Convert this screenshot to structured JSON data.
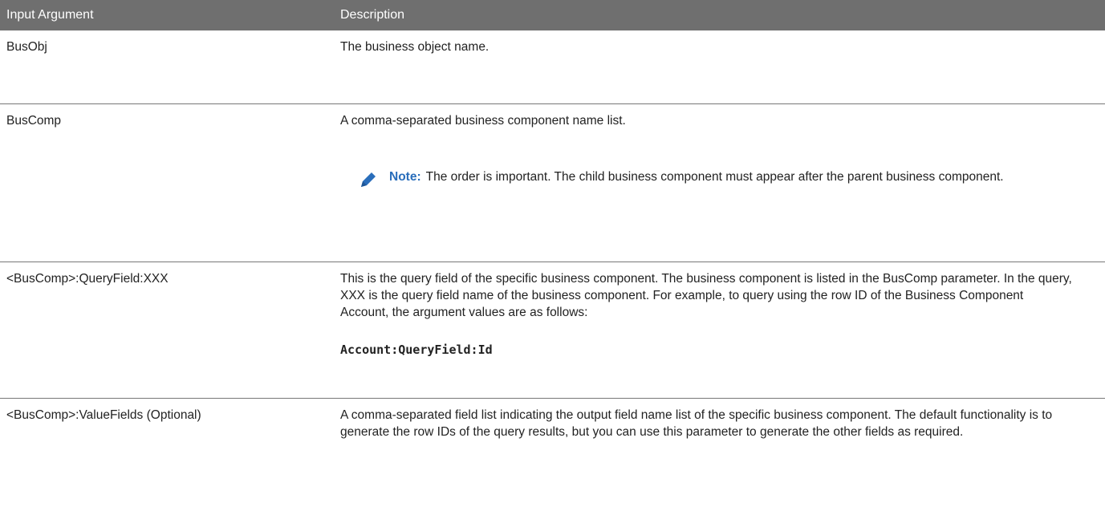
{
  "table": {
    "headers": [
      "Input Argument",
      "Description"
    ],
    "rows": [
      {
        "argument": "BusObj",
        "description": "The business object name."
      },
      {
        "argument": "BusComp",
        "description": "A comma-separated business component name list.",
        "note_label": "Note:",
        "note_text": "The order is important. The child business component must appear after the parent business component."
      },
      {
        "argument": "<BusComp>:QueryField:XXX",
        "description": "This is the query field of the specific business component. The business component is listed in the BusComp parameter. In the query, XXX is the query field name of the business component. For example, to query using the row ID of the Business Component Account, the argument values are as follows:",
        "code": "Account:QueryField:Id"
      },
      {
        "argument": "<BusComp>:ValueFields (Optional)",
        "description": "A comma-separated field list indicating the output field name list of the specific business component. The default functionality is to generate the row IDs of the query results, but you can use this parameter to generate the other fields as required."
      }
    ]
  },
  "icons": {
    "note": "pencil-icon"
  },
  "colors": {
    "header_bg": "#6f6f6f",
    "note_label": "#2a6ebb",
    "note_icon": "#2a6ebb"
  }
}
